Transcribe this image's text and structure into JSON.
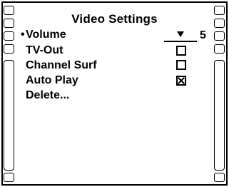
{
  "title": "Video Settings",
  "menu": {
    "selected_marker": "•",
    "items": [
      {
        "label": "Volume",
        "control": "slider",
        "value": "5",
        "level_fraction": 0.5
      },
      {
        "label": "TV-Out",
        "control": "checkbox",
        "checked": false
      },
      {
        "label": "Channel Surf",
        "control": "checkbox",
        "checked": false
      },
      {
        "label": "Auto Play",
        "control": "checkbox",
        "checked": true
      },
      {
        "label": "Delete...",
        "control": "none"
      }
    ]
  },
  "icons": {
    "film_strip": "film-strip-border",
    "slider_thumb": "down-triangle-icon",
    "checkbox_unchecked": "checkbox-empty-icon",
    "checkbox_checked": "checkbox-x-icon"
  },
  "colors": {
    "foreground": "#000000",
    "background": "#ffffff"
  }
}
